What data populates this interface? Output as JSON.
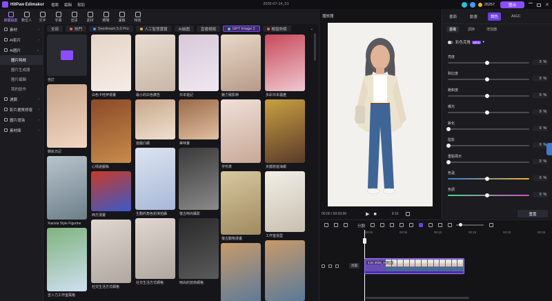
{
  "app": {
    "name": "HitPaw Edimakor",
    "project_name": "2026-07-14_01",
    "points": "26257",
    "export_label": "匯出"
  },
  "menu": [
    "檔案",
    "編輯",
    "幫助"
  ],
  "toolbar": [
    {
      "label": "媒體檔案",
      "icon": "media-icon",
      "active": true
    },
    {
      "label": "數位人",
      "icon": "avatar-icon"
    },
    {
      "label": "文字",
      "icon": "text-icon"
    },
    {
      "label": "字幕",
      "icon": "subtitle-icon"
    },
    {
      "label": "音訊",
      "icon": "audio-icon"
    },
    {
      "label": "素材",
      "icon": "material-icon"
    },
    {
      "label": "轉場",
      "icon": "transition-icon"
    },
    {
      "label": "濾鏡",
      "icon": "filter-icon"
    },
    {
      "label": "特效",
      "icon": "effect-icon"
    }
  ],
  "sidebar": {
    "items": [
      {
        "label": "素材",
        "expanded": false
      },
      {
        "label": "AI影片",
        "expanded": false
      },
      {
        "label": "AI圖片",
        "expanded": true,
        "children": [
          "圖片特效",
          "圖片生成器",
          "圖片編輯",
          "我的創作"
        ],
        "active_child": 0
      },
      {
        "label": "濾鏡",
        "expanded": false
      },
      {
        "label": "影片畫質修復",
        "expanded": false
      },
      {
        "label": "圖片增強",
        "expanded": false
      },
      {
        "label": "素材庫",
        "expanded": false
      }
    ]
  },
  "filters": [
    {
      "label": "全部"
    },
    {
      "label": "熱門",
      "dot": "#ff5a5a"
    },
    {
      "label": "Seedream 5.0 Pro",
      "dot": "#3aa0ff"
    },
    {
      "label": "人工智慧寶寶",
      "dot": "#f0b43a"
    },
    {
      "label": "AI繪圖"
    },
    {
      "label": "直播視頻"
    },
    {
      "label": "GPT Image 2",
      "dot": "#52d08a",
      "active": true
    },
    {
      "label": "櫥窗熱榜",
      "dot": "#ff5a5a"
    }
  ],
  "gallery": [
    {
      "caption": "自訂",
      "custom": true
    },
    {
      "caption": "朝氣日記"
    },
    {
      "caption": "Xianxia Style Figurine"
    },
    {
      "caption": "吉卜力工作室風格"
    },
    {
      "caption": "白色卡哇伊漫畫"
    },
    {
      "caption": "心情遊戲帳"
    },
    {
      "caption": "西方漫畫"
    },
    {
      "caption": "最小的白色廣告"
    },
    {
      "caption": "遊戲凸顯"
    },
    {
      "caption": "生動的角色扮演拍攝"
    },
    {
      "caption": "社交生活方式網格"
    },
    {
      "caption": "日本遊記"
    },
    {
      "caption": "美味畫"
    },
    {
      "caption": "復古時尚攝影"
    },
    {
      "caption": "時尚的技術網格"
    },
    {
      "caption": "魅力電影節"
    },
    {
      "caption": "字形表"
    },
    {
      "caption": "復古動物漫畫"
    },
    {
      "caption": "多彩日本遺產"
    },
    {
      "caption": "京都旅遊海報"
    },
    {
      "caption": "工作室造型"
    },
    {
      "caption": "商業辦公場景"
    }
  ],
  "preview": {
    "title": "播放器",
    "time": "00:00 / 00:03:00",
    "ratio": "9:16"
  },
  "right_panel": {
    "tabs": [
      "畫面",
      "動畫",
      "調色",
      "AIGC"
    ],
    "active_tab": 2,
    "subtabs": [
      "基礎",
      "調節",
      "增強器"
    ],
    "active_subtab": 0,
    "toggle_label": "彩色克隆",
    "toggle_badge": "NEW",
    "adjustments": [
      {
        "label": "亮度",
        "value": "0"
      },
      {
        "label": "對比度",
        "value": "0"
      },
      {
        "label": "飽和度",
        "value": "0"
      },
      {
        "label": "曝光",
        "value": "0"
      },
      {
        "label": "銳化",
        "value": "0"
      },
      {
        "label": "陰影",
        "value": "0"
      },
      {
        "label": "重點標示",
        "value": "0"
      },
      {
        "label": "色溫",
        "value": "0"
      },
      {
        "label": "色調",
        "value": "0"
      }
    ],
    "unit": "%",
    "reset_label": "重置"
  },
  "timeline": {
    "split_label": "分割",
    "cover_label": "封面",
    "clip_name": "3.0s  2026_04_24",
    "ruler": [
      "00:00",
      "00:05",
      "00:10",
      "00:15",
      "00:20",
      "00:25"
    ]
  },
  "colors": {
    "accent": "#8a4dff",
    "background": "#16161a",
    "panel": "#1b1b20"
  }
}
